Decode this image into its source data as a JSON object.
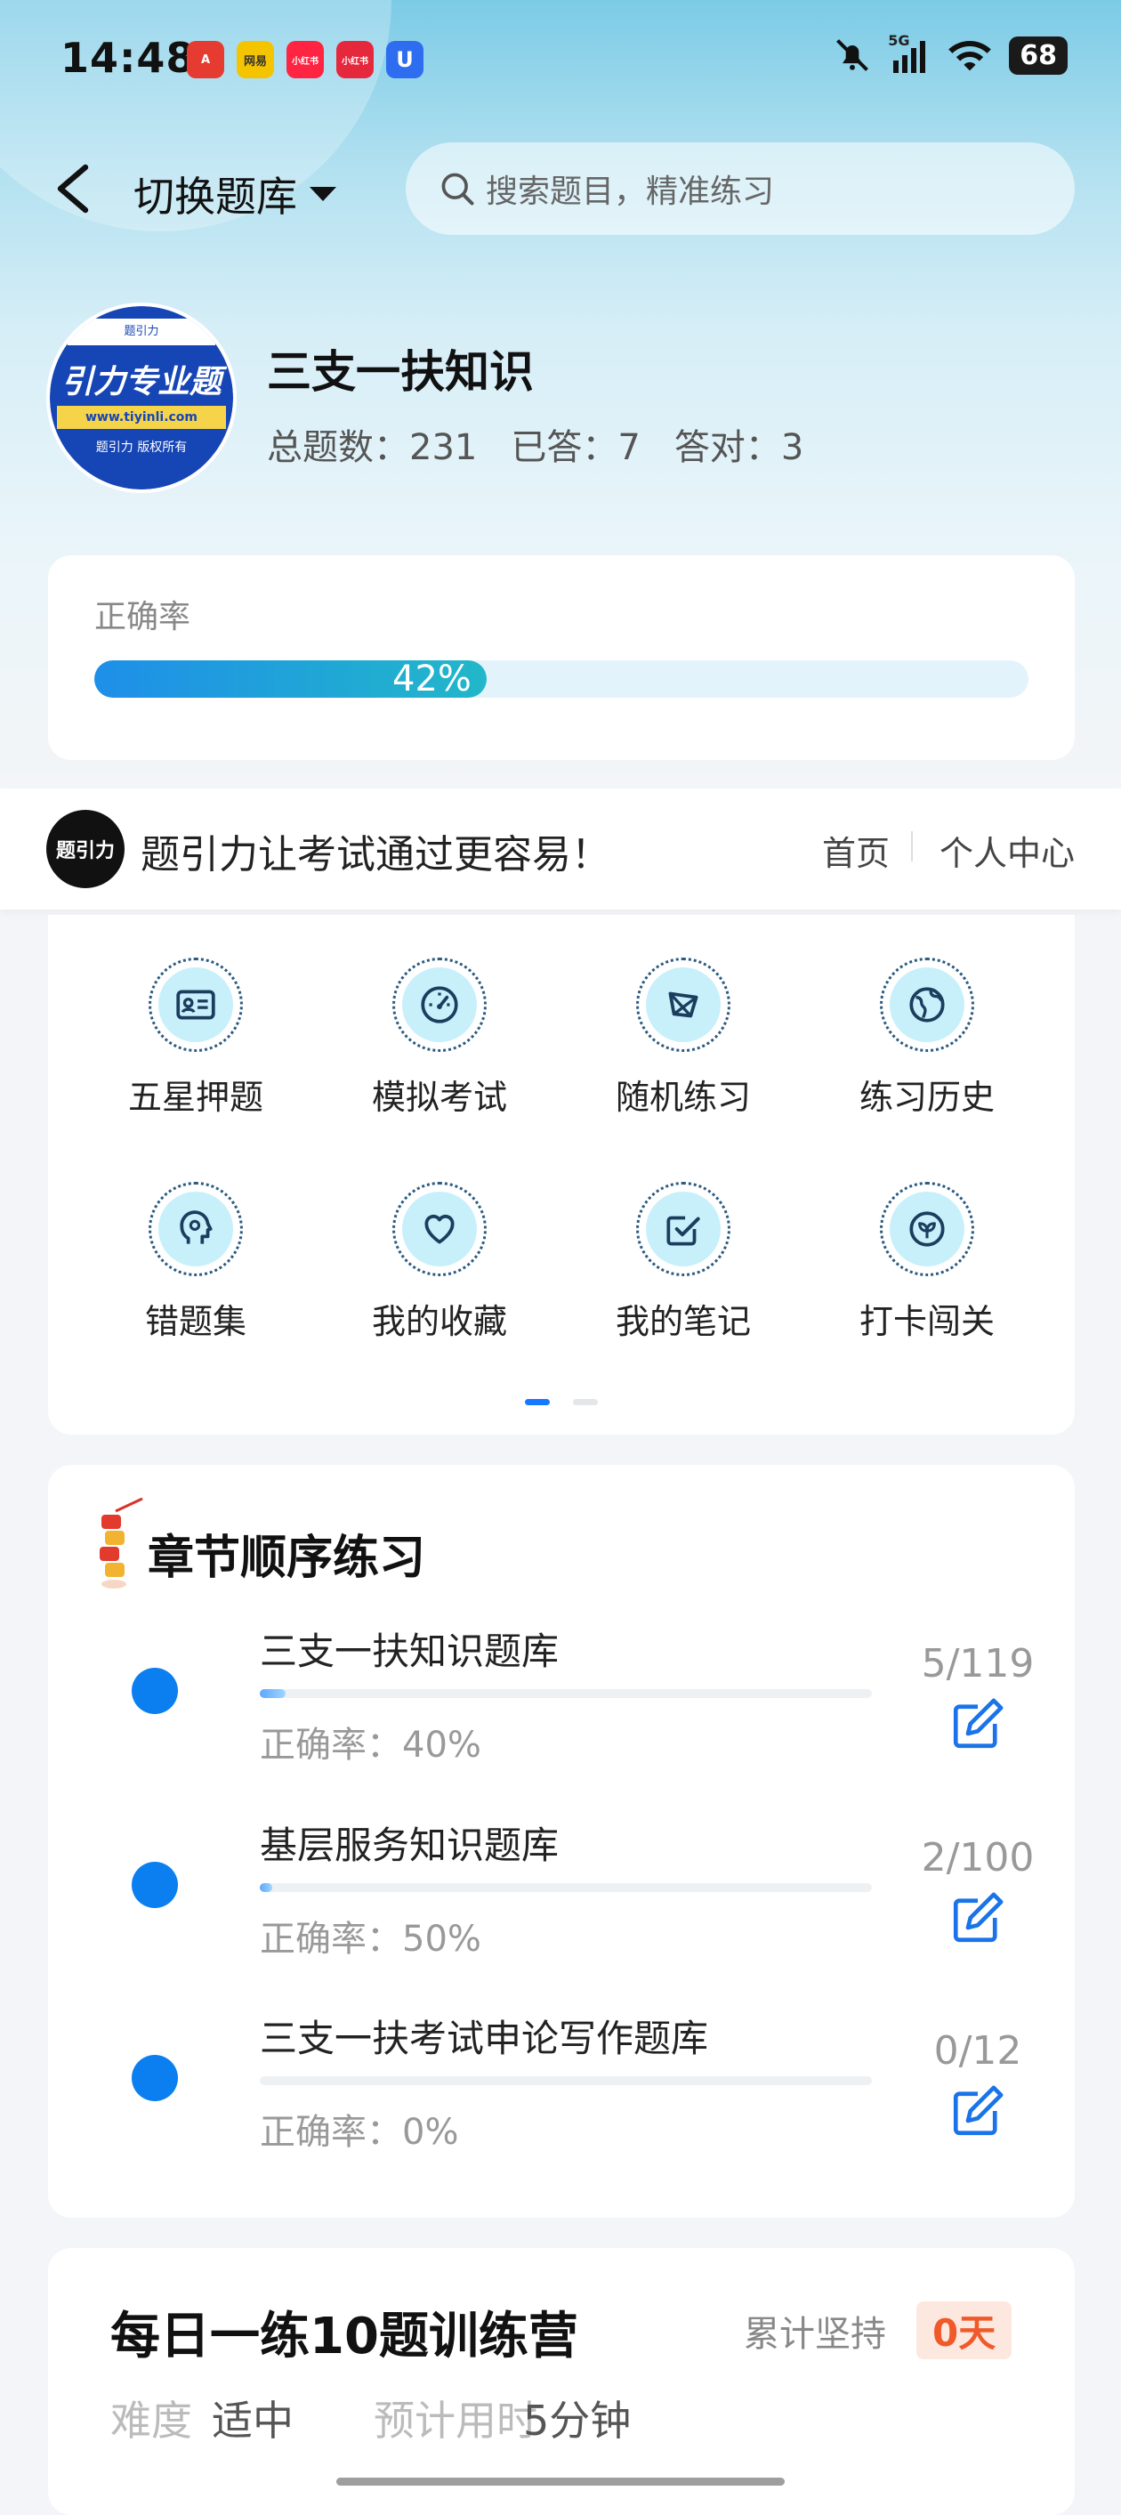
{
  "status": {
    "time": "14:48",
    "network": "5G",
    "battery": "68",
    "app_icons": [
      {
        "text": "A",
        "color": "#e63b30"
      },
      {
        "text": "网易",
        "color": "#f5c400"
      },
      {
        "text": "小红书",
        "color": "#ff2442"
      },
      {
        "text": "小红书",
        "color": "#e6283c"
      },
      {
        "text": "U",
        "color": "#2f6df0"
      }
    ]
  },
  "header": {
    "switch_label": "切换题库",
    "search_placeholder": "搜索题目，精准练习"
  },
  "course": {
    "logo_top": "题引力",
    "logo_main": "引力专业题",
    "logo_url": "www.tiyinli.com",
    "logo_bottom": "题引力 版权所有",
    "title": "三支一扶知识",
    "stats": {
      "total_label": "总题数：",
      "total": "231",
      "answered_label": "已答：",
      "answered": "7",
      "correct_label": "答对：",
      "correct": "3"
    }
  },
  "accuracy": {
    "label": "正确率",
    "percent_text": "42%",
    "fraction": 0.42
  },
  "banner": {
    "logo_text": "题引力",
    "slogan": "题引力让考试通过更容易！",
    "home": "首页",
    "user_center": "个人中心"
  },
  "tools": [
    {
      "label": "五星押题",
      "icon": "id-card-icon"
    },
    {
      "label": "模拟考试",
      "icon": "speedometer-icon"
    },
    {
      "label": "随机练习",
      "icon": "network-icon"
    },
    {
      "label": "练习历史",
      "icon": "globe-icon"
    },
    {
      "label": "错题集",
      "icon": "head-icon"
    },
    {
      "label": "我的收藏",
      "icon": "heart-icon"
    },
    {
      "label": "我的笔记",
      "icon": "checkbox-icon"
    },
    {
      "label": "打卡闯关",
      "icon": "leaf-icon"
    }
  ],
  "chapters_section": {
    "title": "章节顺序练习",
    "items": [
      {
        "title": "三支一扶知识题库",
        "accuracy": "正确率：40%",
        "count": "5/119",
        "progress": 0.042
      },
      {
        "title": "基层服务知识题库",
        "accuracy": "正确率：50%",
        "count": "2/100",
        "progress": 0.02
      },
      {
        "title": "三支一扶考试申论写作题库",
        "accuracy": "正确率：0%",
        "count": "0/12",
        "progress": 0
      }
    ]
  },
  "daily": {
    "title": "每日一练10题训练营",
    "streak_label": "累计坚持",
    "streak_value": "0天",
    "difficulty_label": "难度",
    "difficulty": "适中",
    "time_label": "预计用时",
    "time": "5分钟"
  },
  "colors": {
    "accent": "#1677ff",
    "chapter_dot": "#0b7ff0",
    "streak": "#f05a2a"
  }
}
